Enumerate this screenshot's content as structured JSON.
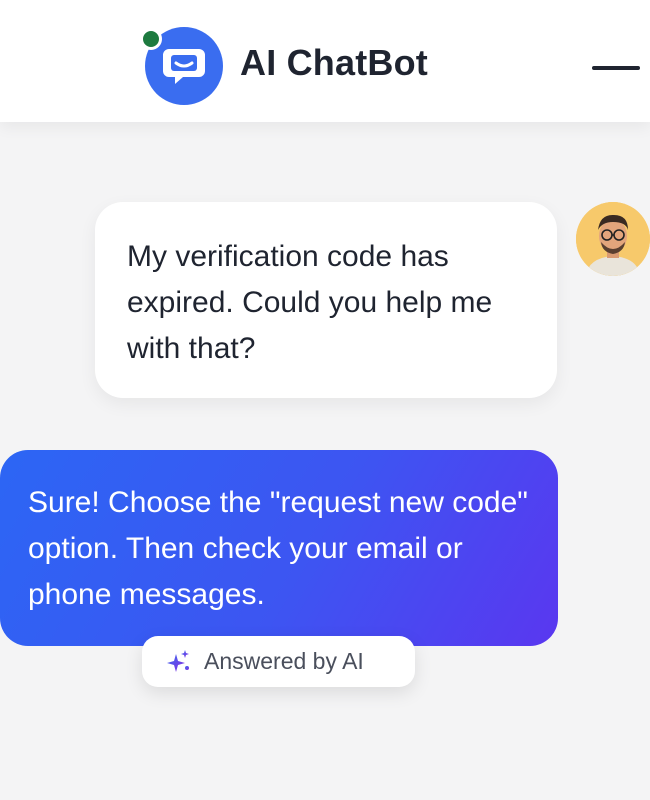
{
  "header": {
    "title": "AI ChatBot",
    "logo_icon": "chat-bubble-icon",
    "status_icon": "online-status-dot",
    "menu_icon": "hamburger-menu-icon"
  },
  "conversation": {
    "user_message": {
      "text": "My verification code has expired. Could you help me with that?",
      "avatar_icon": "user-avatar"
    },
    "bot_message": {
      "text": "Sure! Choose the \"request new code\" option. Then check your email or phone messages.",
      "badge": {
        "label": "Answered by AI",
        "icon": "sparkle-icon"
      }
    }
  },
  "colors": {
    "brand_blue": "#3a6df0",
    "online_green": "#1d7a3f",
    "bot_gradient_start": "#2c66f4",
    "bot_gradient_end": "#5a37f0",
    "avatar_bg": "#f7c96b"
  }
}
